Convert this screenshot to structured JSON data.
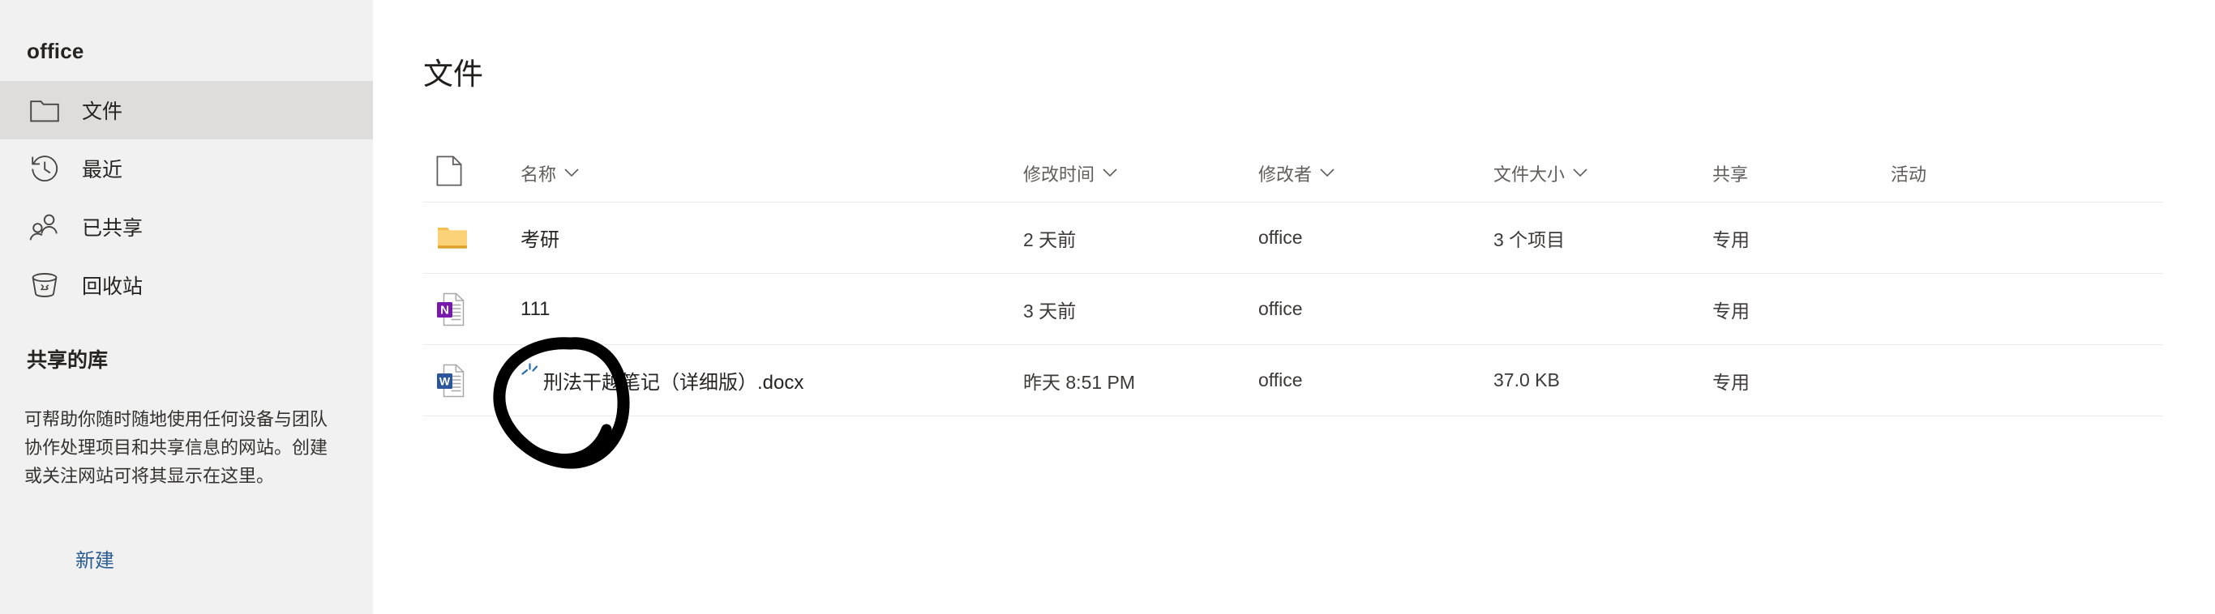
{
  "sidebar": {
    "title": "office",
    "items": [
      {
        "label": "文件",
        "icon": "folder-icon",
        "selected": true
      },
      {
        "label": "最近",
        "icon": "recent-clock-icon",
        "selected": false
      },
      {
        "label": "已共享",
        "icon": "people-icon",
        "selected": false
      },
      {
        "label": "回收站",
        "icon": "recycle-bin-icon",
        "selected": false
      }
    ],
    "shared_library": {
      "heading": "共享的库",
      "description": "可帮助你随时随地使用任何设备与团队协作处理项目和共享信息的网站。创建或关注网站可将其显示在这里。",
      "link_label": "新建"
    }
  },
  "main": {
    "page_title": "文件",
    "columns": [
      {
        "key": "name",
        "label": "名称",
        "sortable": true
      },
      {
        "key": "modified",
        "label": "修改时间",
        "sortable": true
      },
      {
        "key": "modifier",
        "label": "修改者",
        "sortable": true
      },
      {
        "key": "size",
        "label": "文件大小",
        "sortable": true
      },
      {
        "key": "sharing",
        "label": "共享",
        "sortable": false
      },
      {
        "key": "activity",
        "label": "活动",
        "sortable": false
      }
    ],
    "rows": [
      {
        "icon": "folder-icon",
        "name": "考研",
        "modified": "2 天前",
        "modifier": "office",
        "size": "3 个项目",
        "sharing": "专用",
        "activity": "",
        "is_new": false
      },
      {
        "icon": "onenote-file-icon",
        "name": "111",
        "modified": "3 天前",
        "modifier": "office",
        "size": "",
        "sharing": "专用",
        "activity": "",
        "is_new": false
      },
      {
        "icon": "word-file-icon",
        "name": "刑法干越笔记（详细版）.docx",
        "modified": "昨天 8:51 PM",
        "modifier": "office",
        "size": "37.0 KB",
        "sharing": "专用",
        "activity": "",
        "is_new": true
      }
    ]
  },
  "annotation": {
    "shape": "hand-drawn-circle",
    "color": "#000000",
    "target": "word-file-icon-row-3"
  },
  "colors": {
    "sidebar_bg": "#f1f1f1",
    "sidebar_selected_bg": "#dedddc",
    "main_bg": "#ffffff",
    "divider": "#ebebeb",
    "link": "#2c5d92",
    "text_primary": "#252423",
    "text_secondary": "#605e5c",
    "folder_yellow": "#fcd279",
    "word_blue": "#2b579a",
    "onenote_purple": "#7719aa"
  }
}
